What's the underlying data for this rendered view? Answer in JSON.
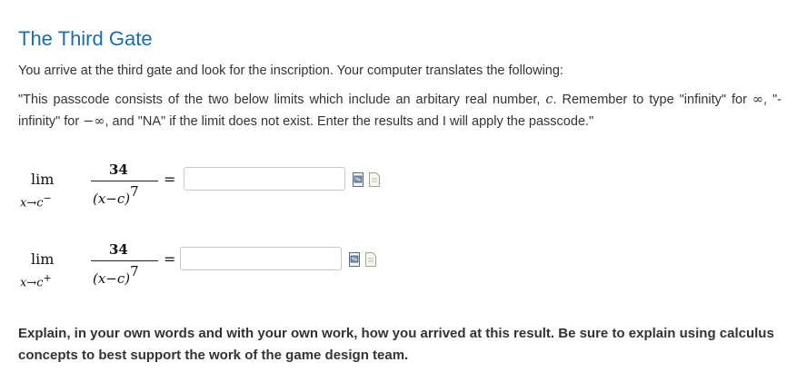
{
  "title": "The Third Gate",
  "intro": "You arrive at the third gate and look for the inscription. Your computer translates the following:",
  "quote": {
    "part1": "\"This passcode consists of the two below limits which include an arbitary real number, ",
    "c": "c",
    "part2": ". Remember to type \"infinity\" for ",
    "inf": "∞",
    "part3": ", \"-infinity\" for ",
    "neginf": "−∞",
    "part4": ", and \"NA\" if the limit does not exist. Enter the results and I will apply the passcode.\""
  },
  "limits": [
    {
      "lim": "lim",
      "sub": "x→c",
      "sub_sup": "−",
      "numerator": "34",
      "denominator": "(x−c)",
      "exponent": "7",
      "equals": "=",
      "value": ""
    },
    {
      "lim": "lim",
      "sub": "x→c",
      "sub_sup": "+",
      "numerator": "34",
      "denominator": "(x−c)",
      "exponent": "7",
      "equals": "=",
      "value": ""
    }
  ],
  "icons": [
    "preview-icon",
    "equation-editor-icon"
  ],
  "explain": "Explain, in your own words and with your own work, how you arrived at this result. Be sure to explain using calculus concepts to best support the work of the game design team.",
  "colors": {
    "title": "#1a6fa8",
    "text": "#333333"
  }
}
